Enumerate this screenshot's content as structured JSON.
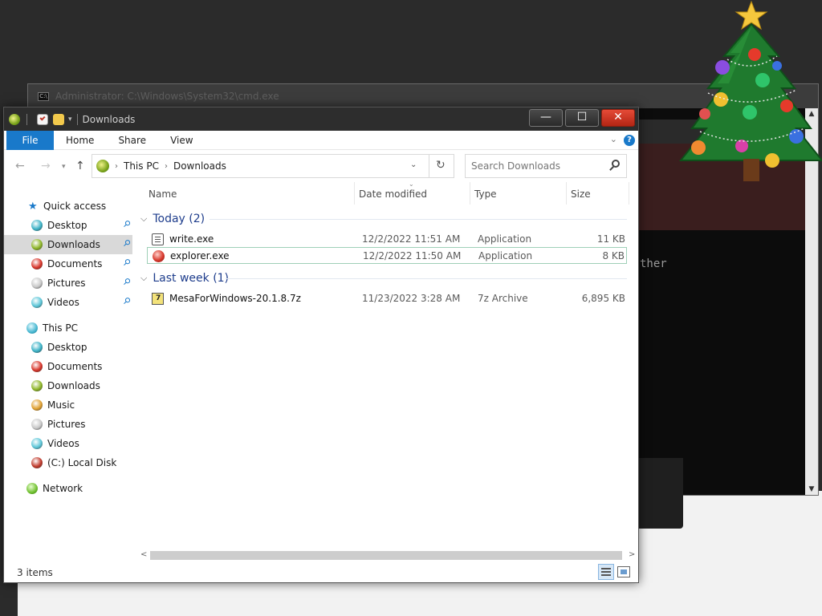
{
  "background": {
    "cmd_title": "Administrator: C:\\Windows\\System32\\cmd.exe",
    "cmd_text": "ther"
  },
  "window": {
    "title": "Downloads",
    "buttons": {
      "minimize": "—",
      "maximize": "☐",
      "close": "✕"
    }
  },
  "ribbon": {
    "tabs": [
      "File",
      "Home",
      "Share",
      "View"
    ],
    "help": "?"
  },
  "nav": {
    "breadcrumb": [
      "This PC",
      "Downloads"
    ],
    "search_placeholder": "Search Downloads"
  },
  "sidebar": {
    "quick_access": "Quick access",
    "quick_items": [
      {
        "label": "Desktop",
        "pinned": true,
        "color": "#3db3c7"
      },
      {
        "label": "Downloads",
        "pinned": true,
        "color": "#8db526",
        "selected": true
      },
      {
        "label": "Documents",
        "pinned": true,
        "color": "#d8352a"
      },
      {
        "label": "Pictures",
        "pinned": true,
        "color": "#c9c9c9"
      },
      {
        "label": "Videos",
        "pinned": true,
        "color": "#5cc6d8"
      }
    ],
    "this_pc": "This PC",
    "pc_items": [
      {
        "label": "Desktop",
        "color": "#3db3c7"
      },
      {
        "label": "Documents",
        "color": "#d8352a"
      },
      {
        "label": "Downloads",
        "color": "#8db526"
      },
      {
        "label": "Music",
        "color": "#e0a030"
      },
      {
        "label": "Pictures",
        "color": "#c9c9c9"
      },
      {
        "label": "Videos",
        "color": "#5cc6d8"
      },
      {
        "label": "(C:) Local Disk",
        "color": "#c0392b"
      }
    ],
    "network": "Network"
  },
  "columns": [
    "Name",
    "Date modified",
    "Type",
    "Size"
  ],
  "groups": [
    {
      "label": "Today (2)",
      "files": [
        {
          "name": "write.exe",
          "date": "12/2/2022 11:51 AM",
          "type": "Application",
          "size": "11 KB",
          "icon": "write-icon"
        },
        {
          "name": "explorer.exe",
          "date": "12/2/2022 11:50 AM",
          "type": "Application",
          "size": "8 KB",
          "icon": "explorer-icon"
        }
      ]
    },
    {
      "label": "Last week (1)",
      "files": [
        {
          "name": "MesaForWindows-20.1.8.7z",
          "date": "11/23/2022 3:28 AM",
          "type": "7z Archive",
          "size": "6,895 KB",
          "icon": "archive-icon"
        }
      ]
    }
  ],
  "status": {
    "item_count": "3 items"
  },
  "colors": {
    "accent": "#1979ca",
    "close": "#d0331f",
    "group_header": "#1e3d8c"
  }
}
